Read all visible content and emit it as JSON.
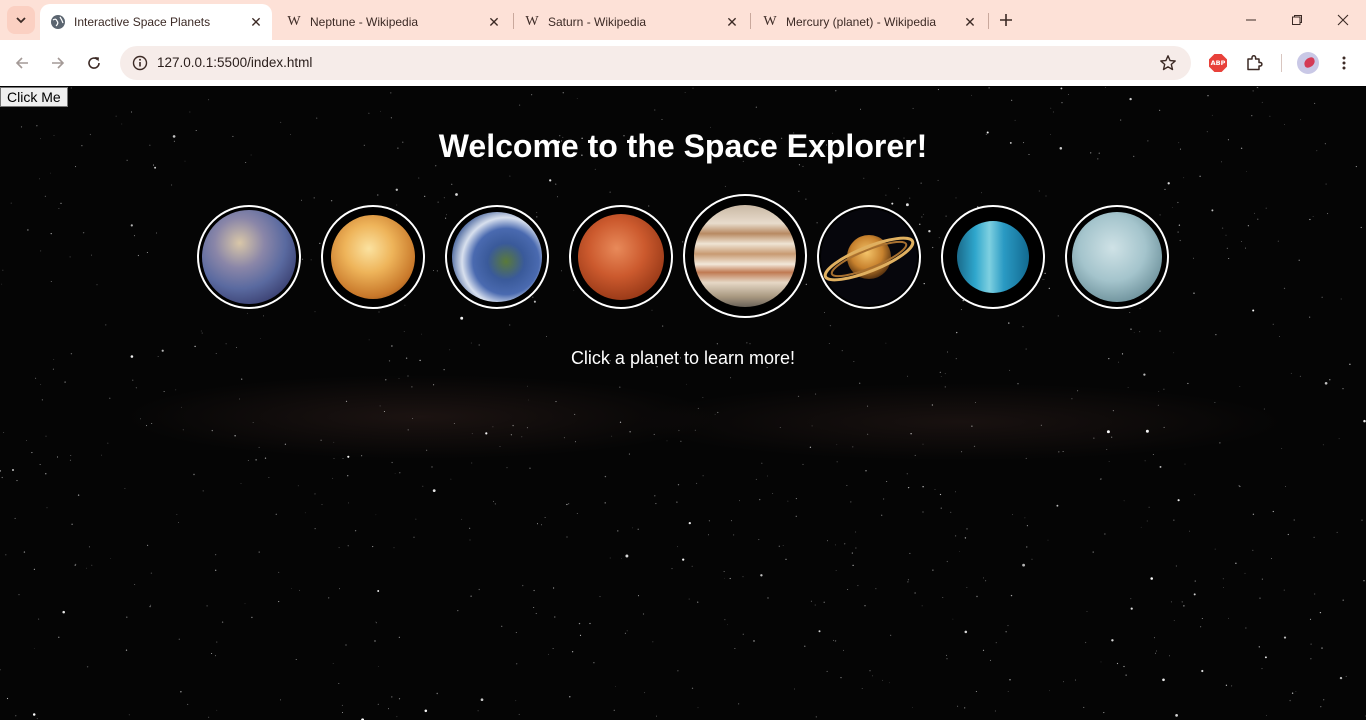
{
  "browser": {
    "tabs": [
      {
        "title": "Interactive Space Planets",
        "active": true,
        "favicon": "globe-icon"
      },
      {
        "title": "Neptune - Wikipedia",
        "active": false,
        "favicon": "wikipedia-icon"
      },
      {
        "title": "Saturn - Wikipedia",
        "active": false,
        "favicon": "wikipedia-icon"
      },
      {
        "title": "Mercury (planet) - Wikipedia",
        "active": false,
        "favicon": "wikipedia-icon"
      }
    ],
    "address": "127.0.0.1:5500/index.html",
    "wiki_glyph": "W"
  },
  "extensions": {
    "adblock_label": "ABP"
  },
  "page": {
    "button_label": "Click Me",
    "heading": "Welcome to the Space Explorer!",
    "hint": "Click a planet to learn more!",
    "planets": [
      {
        "name": "mercury",
        "color": "#7d7890"
      },
      {
        "name": "venus",
        "color": "#e0a050"
      },
      {
        "name": "earth",
        "color": "#3a5a9a"
      },
      {
        "name": "mars",
        "color": "#c0522a"
      },
      {
        "name": "jupiter",
        "color": "#cfb89a"
      },
      {
        "name": "saturn",
        "color": "#d89a3a"
      },
      {
        "name": "uranus",
        "color": "#2aa0c8"
      },
      {
        "name": "neptune",
        "color": "#a8c8d0"
      }
    ]
  }
}
